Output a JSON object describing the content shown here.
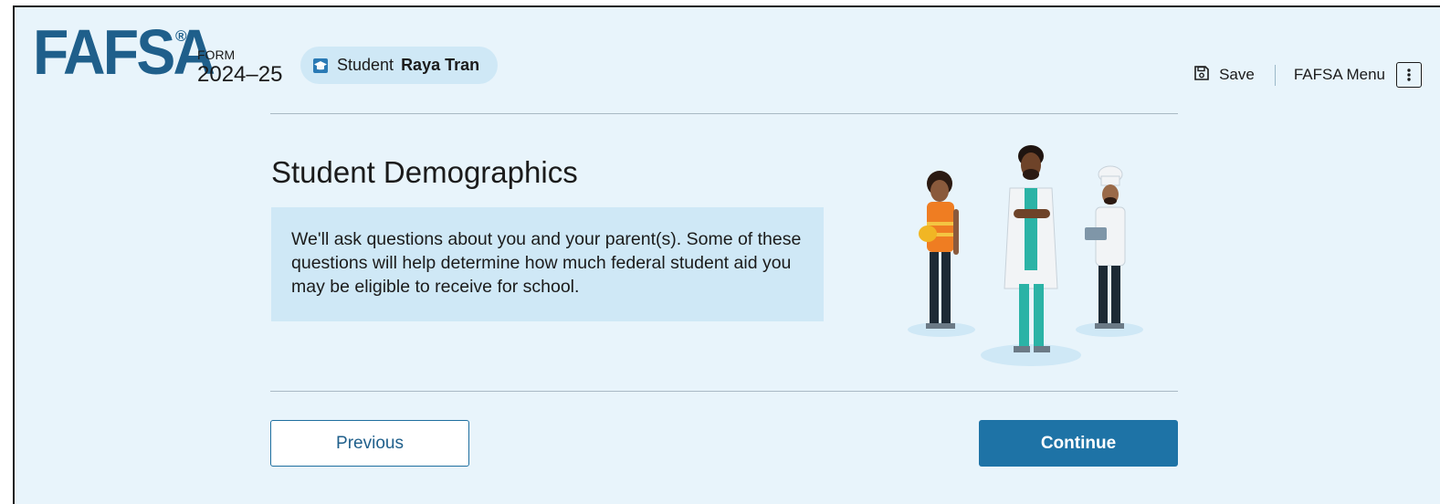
{
  "header": {
    "logo_text": "FAFSA",
    "registered_mark": "®",
    "form_label": "FORM",
    "form_year": "2024–25",
    "student_role": "Student",
    "student_name": "Raya Tran",
    "save_label": "Save",
    "menu_label": "FAFSA Menu"
  },
  "main": {
    "title": "Student Demographics",
    "info_text": "We'll ask questions about you and your parent(s). Some of these questions will help determine how much federal student aid you may be eligible to receive for school."
  },
  "nav": {
    "previous_label": "Previous",
    "continue_label": "Continue"
  },
  "colors": {
    "brand": "#1f5f8b",
    "page_background": "#e8f4fb",
    "info_background": "#cfe8f6",
    "primary_button": "#1e73a6"
  },
  "icons": {
    "student": "graduation-cap-icon",
    "save": "floppy-disk-icon",
    "menu": "kebab-menu-icon"
  }
}
